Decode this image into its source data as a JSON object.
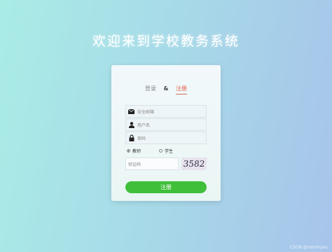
{
  "page": {
    "title": "欢迎来到学校教务系统"
  },
  "tabs": {
    "login": "登录",
    "separator": "&",
    "register": "注册"
  },
  "form": {
    "email_placeholder": "安全邮箱",
    "username_placeholder": "用户名",
    "password_placeholder": "密码",
    "roles": [
      {
        "label": "教师",
        "selected": true
      },
      {
        "label": "学生",
        "selected": false
      }
    ],
    "captcha_placeholder": "验证码",
    "captcha_text": "3582",
    "submit_label": "注册"
  },
  "watermark": "CSDN @rotorhyeu",
  "colors": {
    "accent_red": "#e2624e",
    "button_green": "#3fbf3a"
  },
  "icons": [
    "mail-icon",
    "user-icon",
    "lock-icon"
  ]
}
